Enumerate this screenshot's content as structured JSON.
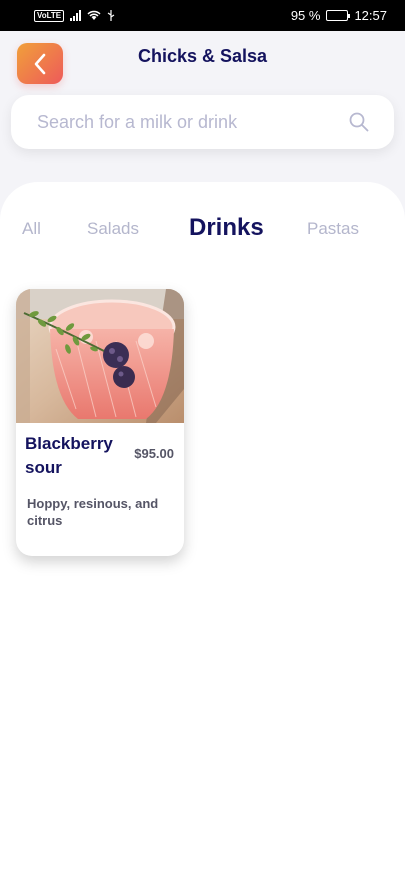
{
  "status_bar": {
    "network_badge": "VoLTE",
    "battery_percent": "95 %",
    "time": "12:57",
    "battery_level": 0.95
  },
  "header": {
    "title": "Chicks & Salsa",
    "back_icon": "chevron-left-icon",
    "accent_gradient": [
      "#f0a03a",
      "#ee5a5a"
    ]
  },
  "search": {
    "placeholder": "Search for a milk or drink",
    "value": "",
    "icon": "search-icon"
  },
  "categories": {
    "tabs": [
      {
        "label": "All"
      },
      {
        "label": "Salads"
      },
      {
        "label": "Drinks"
      },
      {
        "label": "Pastas"
      }
    ],
    "active": "Drinks",
    "active_color": "#14135e",
    "inactive_color": "#b4b6cc"
  },
  "products": [
    {
      "name": "Blackberry sour",
      "price": "$95.00",
      "description": "Hoppy, resinous, and citrus"
    }
  ]
}
